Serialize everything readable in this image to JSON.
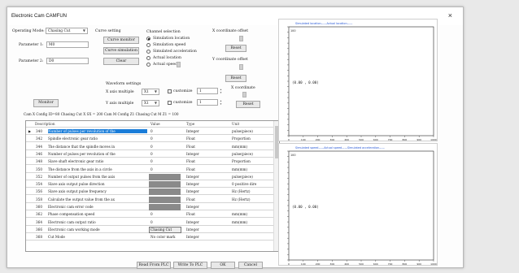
{
  "window": {
    "title": "Electronic Cam CAMFUN",
    "close": "×"
  },
  "operating": {
    "label": "Operating Mode:",
    "value": "Chasing Cut"
  },
  "params": [
    {
      "label": "Parameter 1:",
      "value": "M0"
    },
    {
      "label": "Parameter 2:",
      "value": "D0"
    }
  ],
  "curve": {
    "label": "Curve setting",
    "monitor": "Curve monitor",
    "simulation": "Curve simulation",
    "clear": "Clear"
  },
  "channel": {
    "label": "Channel selection",
    "options": [
      "Simulation location",
      "Simulation speed",
      "Simulated acceleration",
      "Actual location",
      "Actual speed"
    ]
  },
  "x_offset": {
    "label": "X coordinate offset",
    "reset": "Reset"
  },
  "y_offset": {
    "label": "Y coordinate offset",
    "reset": "Reset"
  },
  "waveform": {
    "label": "Waveform settings",
    "x_mult": "X axis multiple",
    "y_mult": "Y axis multiple",
    "x_val": "X1",
    "y_val": "X1",
    "customize": "customize",
    "x_custom": "1",
    "y_custom": "1"
  },
  "x_coord": {
    "label": "X coordinate",
    "reset": "Reset"
  },
  "monitor_btn": "Monitor",
  "config_line": "Cam X Config ID=80   Chasing Cut X SX = 200   Cam M Config Z1   Chasing Cut M Z1 = 100",
  "table": {
    "headers": [
      "Description",
      "Value",
      "Type",
      "Unit"
    ],
    "rows": [
      {
        "id": "340",
        "desc": "Number of pulses per revolution of the",
        "value": "0",
        "type": "Integer",
        "unit": "pulse(piece)"
      },
      {
        "id": "342",
        "desc": "Spindle electronic gear ratio",
        "value": "0",
        "type": "Float",
        "unit": "Proportion"
      },
      {
        "id": "344",
        "desc": "The distance that the spindle moves in",
        "value": "0",
        "type": "Float",
        "unit": "mm(mm)"
      },
      {
        "id": "346",
        "desc": "Number of pulses per revolution of the",
        "value": "0",
        "type": "Integer",
        "unit": "pulse(piece)"
      },
      {
        "id": "348",
        "desc": "Slave shaft electronic gear ratio",
        "value": "0",
        "type": "Float",
        "unit": "Proportion"
      },
      {
        "id": "350",
        "desc": "The distance from the axis in a circle",
        "value": "0",
        "type": "Float",
        "unit": "mm(mm)"
      },
      {
        "id": "352",
        "desc": "Number of output pulses from the axis",
        "value": "",
        "type": "Integer",
        "unit": "pulse(piece)"
      },
      {
        "id": "354",
        "desc": "Slave axis output pulse direction",
        "value": "",
        "type": "Integer",
        "unit": "0 positive dire"
      },
      {
        "id": "356",
        "desc": "Slave axis output pulse frequency",
        "value": "",
        "type": "Integer",
        "unit": "Hz (Hertz)"
      },
      {
        "id": "358",
        "desc": "Calculate the output value from the ax",
        "value": "",
        "type": "Float",
        "unit": "Hz (Hertz)"
      },
      {
        "id": "360",
        "desc": "Electronic cam error code",
        "value": "",
        "type": "Integer",
        "unit": ""
      },
      {
        "id": "362",
        "desc": "Phase compensation speed",
        "value": "0",
        "type": "Float",
        "unit": "mm(mm)"
      },
      {
        "id": "364",
        "desc": "Electronic cam output ratio",
        "value": "0",
        "type": "Integer",
        "unit": "mm(mm)"
      },
      {
        "id": "366",
        "desc": "Electronic cam working mode",
        "value": "Chasing Cut",
        "type": "Integer",
        "unit": ""
      },
      {
        "id": "368",
        "desc": "Cut Mode",
        "value": "No color mark",
        "type": "Integer",
        "unit": ""
      }
    ]
  },
  "footer": {
    "read": "Read From PLC",
    "write": "Write To PLC",
    "ok": "OK",
    "cancel": "Cancel"
  },
  "charts": [
    {
      "legend": "Simulated location——Actual location——",
      "point": "(0.00 , 0.00)",
      "y_max": "100",
      "x_ticks": [
        "0",
        "100",
        "200",
        "300",
        "400",
        "500",
        "600",
        "700",
        "800",
        "900",
        "1000"
      ]
    },
    {
      "legend": "Simulated speed——Actual speed——Simulated acceleration——",
      "point": "(0.00 , 0.00)",
      "y_max": "100",
      "x_ticks": [
        "0",
        "100",
        "200",
        "300",
        "400",
        "500",
        "600",
        "700",
        "800",
        "900",
        "1000"
      ]
    }
  ],
  "colors": {
    "selection": "#1a7dd9",
    "legend_red": "#d22",
    "legend_blue": "#2456d6",
    "gray_cell": "#8a8a8a"
  }
}
